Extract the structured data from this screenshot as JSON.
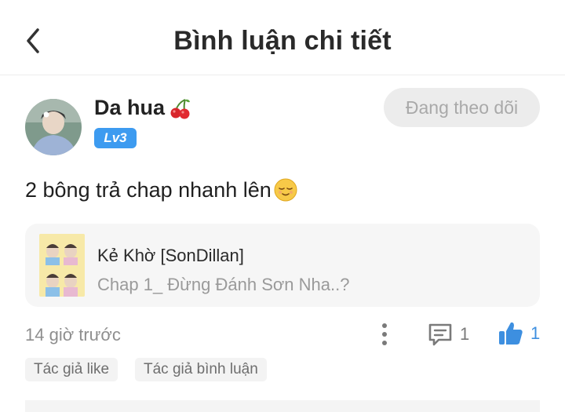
{
  "header": {
    "title": "Bình luận chi tiết",
    "back_icon": "chevron-left-icon"
  },
  "comment": {
    "username": "Da hua",
    "username_emoji": "cherry-icon",
    "level": "Lv3",
    "follow_label": "Đang theo dõi",
    "text": "2 bông trả chap nhanh lên",
    "text_emoji": "relieved-face-icon",
    "story": {
      "title": "Kẻ Khờ [SonDillan]",
      "chapter": "Chap 1_ Đừng Đánh Sơn Nha..?"
    },
    "timestamp": "14 giờ trước",
    "reply_count": "1",
    "like_count": "1",
    "tags": [
      "Tác giả like",
      "Tác giả bình luận"
    ]
  },
  "colors": {
    "accent": "#3d9bf0",
    "like": "#3d8fe0",
    "follow_bg": "#ececec",
    "card_bg": "#f6f6f6"
  }
}
